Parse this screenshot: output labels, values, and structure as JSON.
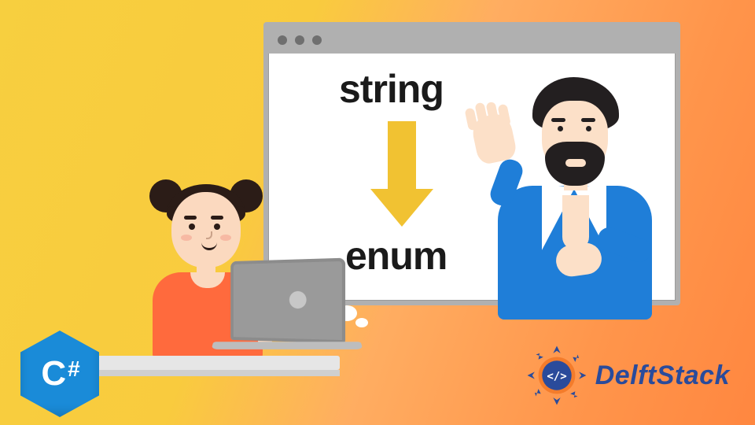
{
  "labels": {
    "string": "string",
    "enum": "enum"
  },
  "badges": {
    "csharp_letter": "C",
    "csharp_hash": "#"
  },
  "brand": {
    "name": "DelftStack",
    "code_glyph": "</>"
  },
  "colors": {
    "arrow": "#f1c232",
    "csharp_bg": "#1a8bd8",
    "brand_text": "#2a4b9b",
    "man_coat": "#1f7ed8",
    "girl_shirt": "#ff6a3d"
  }
}
